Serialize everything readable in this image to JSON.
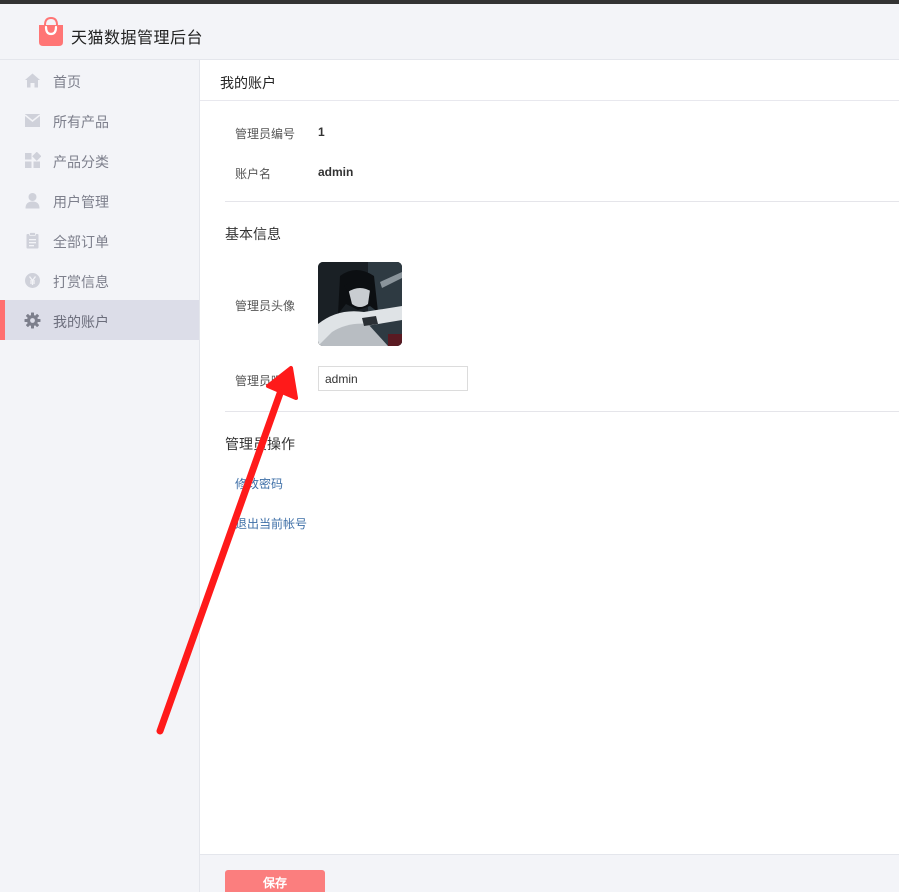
{
  "app": {
    "title": "天猫数据管理后台",
    "logo_icon": "shopping-bag-icon",
    "brand_color": "#ff7575"
  },
  "sidebar": {
    "items": [
      {
        "label": "首页",
        "icon": "home-icon",
        "active": false
      },
      {
        "label": "所有产品",
        "icon": "envelope-icon",
        "active": false
      },
      {
        "label": "产品分类",
        "icon": "grid-icon",
        "active": false
      },
      {
        "label": "用户管理",
        "icon": "user-icon",
        "active": false
      },
      {
        "label": "全部订单",
        "icon": "clipboard-icon",
        "active": false
      },
      {
        "label": "打赏信息",
        "icon": "yen-coin-icon",
        "active": false
      },
      {
        "label": "我的账户",
        "icon": "gear-icon",
        "active": true
      }
    ],
    "active_accent": "#ff6f6f"
  },
  "page": {
    "title": "我的账户"
  },
  "account": {
    "id_label": "管理员编号",
    "id_value": "1",
    "username_label": "账户名",
    "username_value": "admin"
  },
  "basic_info": {
    "title": "基本信息",
    "avatar_label": "管理员头像",
    "nickname_label": "管理员昵称",
    "nickname_value": "admin"
  },
  "operations": {
    "title": "管理员操作",
    "change_password": "修改密码",
    "logout": "退出当前帐号"
  },
  "footer": {
    "save_label": "保存"
  },
  "annotation": {
    "arrow_color": "#ff1a1a"
  }
}
